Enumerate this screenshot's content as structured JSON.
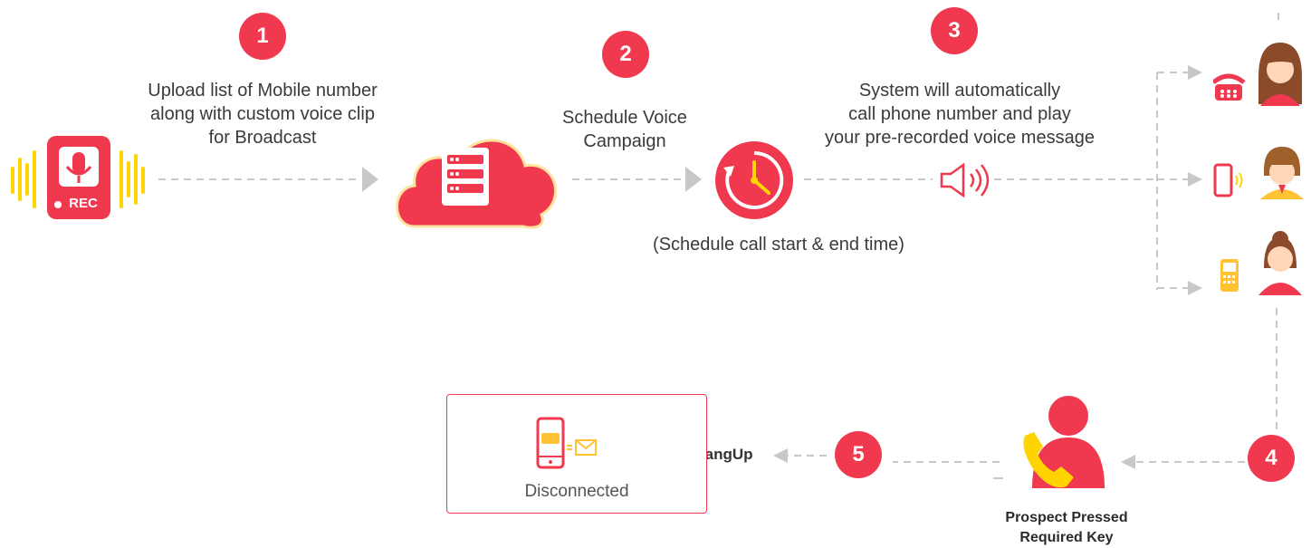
{
  "steps": {
    "s1": {
      "number": "1",
      "caption": "Upload list of Mobile number\nalong with custom voice clip\nfor Broadcast"
    },
    "s2": {
      "number": "2",
      "caption": "Schedule Voice\nCampaign"
    },
    "s3": {
      "number": "3",
      "caption": "System will automatically\ncall phone number and play\nyour pre-recorded voice message"
    },
    "s4": {
      "number": "4",
      "caption": "Prospect Pressed\nRequired Key"
    },
    "s5": {
      "number": "5"
    }
  },
  "recorder": {
    "label": "REC"
  },
  "schedule_note": "(Schedule call start & end time)",
  "hangup_label": "HangUp",
  "result": {
    "label": "Disconnected"
  },
  "colors": {
    "accent": "#f0384f",
    "highlight": "#ffd400",
    "connector": "#c8c8c8"
  }
}
